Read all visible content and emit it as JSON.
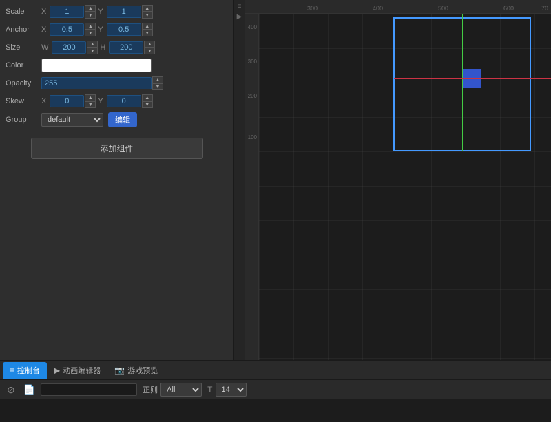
{
  "leftPanel": {
    "rows": [
      {
        "id": "scale",
        "label": "Scale",
        "xLabel": "X",
        "xValue": "1",
        "yLabel": "Y",
        "yValue": "1"
      },
      {
        "id": "anchor",
        "label": "Anchor",
        "xLabel": "X",
        "xValue": "0.5",
        "yLabel": "Y",
        "yValue": "0.5"
      },
      {
        "id": "size",
        "label": "Size",
        "wLabel": "W",
        "wValue": "200",
        "hLabel": "H",
        "hValue": "200"
      },
      {
        "id": "color",
        "label": "Color"
      },
      {
        "id": "opacity",
        "label": "Opacity",
        "value": "255"
      },
      {
        "id": "skew",
        "label": "Skew",
        "xLabel": "X",
        "xValue": "0",
        "yLabel": "Y",
        "yValue": "0"
      },
      {
        "id": "group",
        "label": "Group",
        "value": "default",
        "editLabel": "编辑"
      }
    ],
    "addComponentLabel": "添加组件"
  },
  "tabs": [
    {
      "id": "console",
      "label": "控制台",
      "icon": "≡",
      "active": true
    },
    {
      "id": "animation",
      "label": "动画编辑器",
      "icon": "▶",
      "active": false
    },
    {
      "id": "preview",
      "label": "游戏预览",
      "icon": "📷",
      "active": false
    }
  ],
  "consoleToolbar": {
    "clearIcon": "⊘",
    "fileIcon": "📄",
    "searchPlaceholder": "",
    "filterLabel": "正则",
    "filterOption": "All",
    "fontSizeValue": "14"
  },
  "canvas": {
    "rulerLabels": {
      "h": [
        "300",
        "400",
        "500",
        "600",
        "70"
      ],
      "v": [
        "400",
        "300",
        "200",
        "100"
      ]
    }
  }
}
